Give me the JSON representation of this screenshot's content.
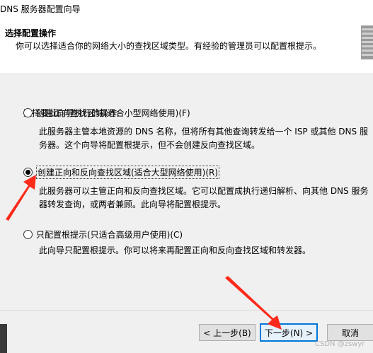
{
  "window": {
    "title": "DNS 服务器配置向导"
  },
  "header": {
    "title": "选择配置操作",
    "description": "你可以选择适合你的网络大小的查找区域类型。有经验的管理员可以配置根提示。"
  },
  "content": {
    "prompt": "选择要此向导执行的操作:",
    "options": [
      {
        "label": "创建正向查找区域(适合小型网络使用)(F)",
        "selected": false,
        "description": "此服务器主管本地资源的 DNS 名称，但将所有其他查询转发给一个 ISP 或其他 DNS 服务器。这个向导将配置根提示，但不会创建反向查找区域。"
      },
      {
        "label": "创建正向和反向查找区域(适合大型网络使用)(R)",
        "selected": true,
        "description": "此服务器可以主管正向和反向查找区域。它可以配置成执行递归解析、向其他 DNS 服务器转发查询，或两者兼顾。此向导将配置根提示。"
      },
      {
        "label": "只配置根提示(只适合高级用户使用)(C)",
        "selected": false,
        "description": "此向导只配置根提示。你可以将来再配置正向和反向查找区域和转发器。"
      }
    ]
  },
  "buttons": {
    "back": "< 上一步(B)",
    "next": "下一步(N) >",
    "cancel": "取消"
  },
  "annotations": {
    "arrow_color": "#ff2a1a"
  },
  "watermark": "CSDN @zswyr"
}
